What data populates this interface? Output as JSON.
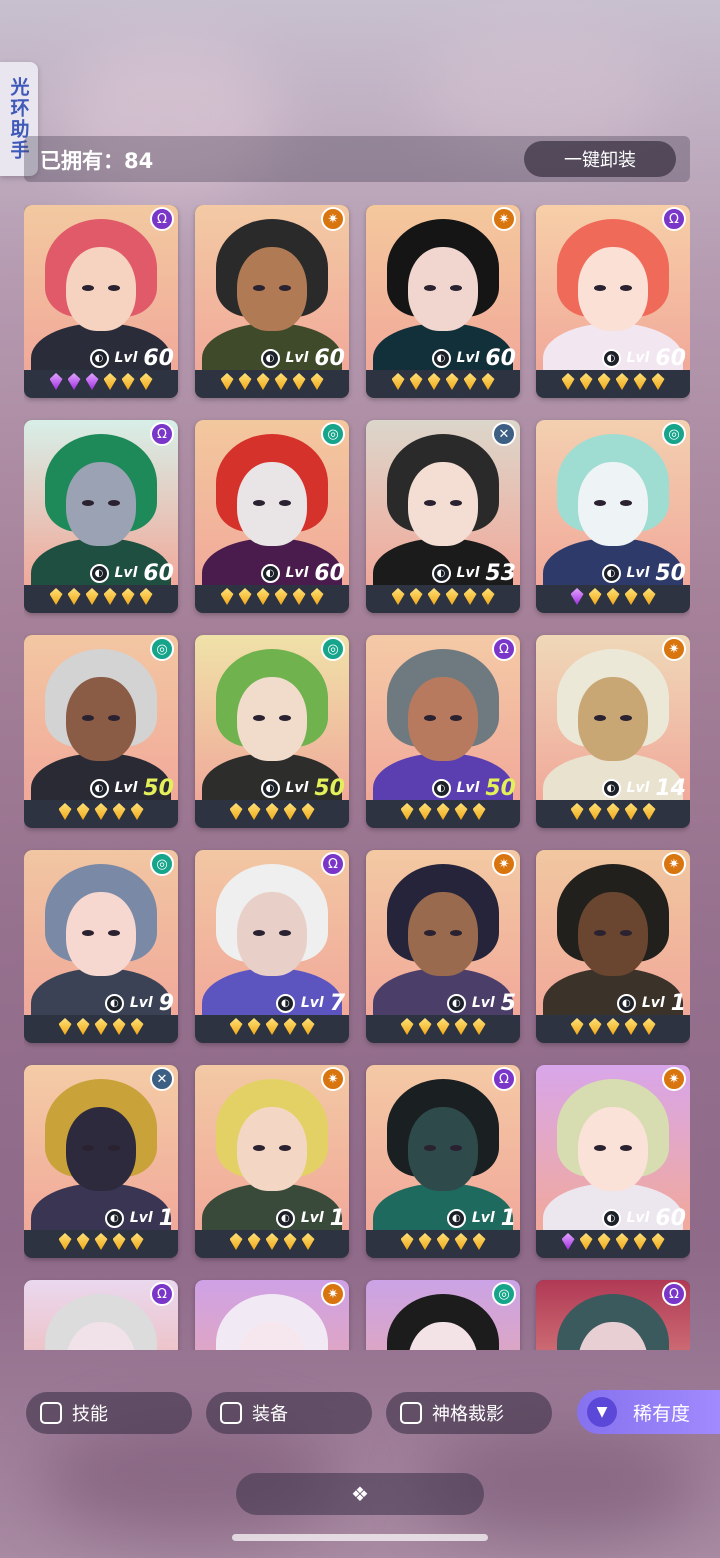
{
  "side_tab": {
    "label": "光环助手"
  },
  "owned": {
    "label": "已拥有：84"
  },
  "unequip_button": {
    "label": "一键卸装"
  },
  "cards": [
    {
      "level": "60",
      "element": "arcane",
      "gems": "pppyyy",
      "bg": "#f2c9a0",
      "hair": "#e05a6a",
      "skin": "#f6d2c0",
      "outfit": "#2b2c3a"
    },
    {
      "level": "60",
      "element": "solar",
      "gems": "yyyyyy",
      "bg": "#f3caa4",
      "hair": "#2a2a2a",
      "skin": "#b07a55",
      "outfit": "#3f4a2a"
    },
    {
      "level": "60",
      "element": "solar",
      "gems": "yyyyyy",
      "bg": "#f4c89c",
      "hair": "#151515",
      "skin": "#f0d6cf",
      "outfit": "#12303a"
    },
    {
      "level": "60",
      "element": "arcane",
      "gems": "yyyyyy",
      "bg": "#f7cfa8",
      "hair": "#f06a5a",
      "skin": "#fbe0d6",
      "outfit": "#f2e6f0"
    },
    {
      "level": "60",
      "element": "arcane",
      "gems": "yyyyyy",
      "bg": "#d7efe8",
      "hair": "#1e8a5a",
      "skin": "#9aa2b4",
      "outfit": "#1f4f40"
    },
    {
      "level": "60",
      "element": "void",
      "gems": "yyyyyy",
      "bg": "#f3c89e",
      "hair": "#d5322c",
      "skin": "#e9e4e6",
      "outfit": "#4a1b4d"
    },
    {
      "level": "53",
      "element": "strand",
      "gems": "yyyyyy",
      "bg": "#dcd6cb",
      "hair": "#2a2a2a",
      "skin": "#f4ddd3",
      "outfit": "#1b1b1b"
    },
    {
      "level": "50",
      "element": "void",
      "gems": "pyyyy",
      "bg": "#f3d0b0",
      "hair": "#9fdcd2",
      "skin": "#eef4f6",
      "outfit": "#2d3a6a"
    },
    {
      "level": "50",
      "element": "void",
      "gems": "yyyyy",
      "bg": "#f3c7a2",
      "hair": "#d3d3d3",
      "skin": "#8a5b45",
      "outfit": "#2a2a35",
      "yellow": true
    },
    {
      "level": "50",
      "element": "void",
      "gems": "yyyyy",
      "bg": "#efe2a8",
      "hair": "#6fb24e",
      "skin": "#f1dccc",
      "outfit": "#2d2e2b",
      "yellow": true
    },
    {
      "level": "50",
      "element": "arcane",
      "gems": "yyyyy",
      "bg": "#f4caa6",
      "hair": "#6f7a80",
      "skin": "#b77a5f",
      "outfit": "#5b3fb0",
      "yellow": true
    },
    {
      "level": "14",
      "element": "solar",
      "gems": "yyyyy",
      "bg": "#efd8b8",
      "hair": "#ece8d8",
      "skin": "#c9a775",
      "outfit": "#e8e2cf"
    },
    {
      "level": "9",
      "element": "void",
      "gems": "yyyyy",
      "bg": "#f1c6a2",
      "hair": "#7a8aa6",
      "skin": "#f6d8d0",
      "outfit": "#3c4256"
    },
    {
      "level": "7",
      "element": "arcane",
      "gems": "yyyyy",
      "bg": "#f2c7a3",
      "hair": "#efefef",
      "skin": "#e8d0c8",
      "outfit": "#5c55c0"
    },
    {
      "level": "5",
      "element": "solar",
      "gems": "yyyyy",
      "bg": "#f3c9a3",
      "hair": "#25243a",
      "skin": "#9a6a4e",
      "outfit": "#4b3f6a"
    },
    {
      "level": "1",
      "element": "solar",
      "gems": "yyyyy",
      "bg": "#f1c7a0",
      "hair": "#22201c",
      "skin": "#6a4630",
      "outfit": "#3b322a"
    },
    {
      "level": "1",
      "element": "strand",
      "gems": "yyyyy",
      "bg": "#f4cca6",
      "hair": "#c9a23a",
      "skin": "#2e2a3e",
      "outfit": "#3a3552"
    },
    {
      "level": "1",
      "element": "solar",
      "gems": "yyyyy",
      "bg": "#f3c9a4",
      "hair": "#e3d165",
      "skin": "#f3d7c4",
      "outfit": "#3a4a3a"
    },
    {
      "level": "1",
      "element": "arcane",
      "gems": "yyyyy",
      "bg": "#f4c9a5",
      "hair": "#1a1f22",
      "skin": "#2e4a4a",
      "outfit": "#1f6a5e"
    },
    {
      "level": "60",
      "element": "solar",
      "gems": "pyyyyy",
      "bg": "#d8a6ea",
      "hair": "#d7ddb0",
      "skin": "#fbe2d8",
      "outfit": "#ece6ef"
    },
    {
      "level": "",
      "element": "arcane",
      "gems": "",
      "bg": "#ead8ee",
      "hair": "#dcdcdc",
      "skin": "#f0e2e8",
      "outfit": "#ddd"
    },
    {
      "level": "",
      "element": "solar",
      "gems": "",
      "bg": "#cfa2e6",
      "hair": "#f1eaf4",
      "skin": "#f6e6ee",
      "outfit": "#2a2a35"
    },
    {
      "level": "",
      "element": "void",
      "gems": "",
      "bg": "#cba3e6",
      "hair": "#1c1c1c",
      "skin": "#f3e2e6",
      "outfit": "#222"
    },
    {
      "level": "",
      "element": "arcane",
      "gems": "",
      "bg": "#b03a55",
      "hair": "#3a5a5e",
      "skin": "#e7cfd3",
      "outfit": "#2a2a2a"
    }
  ],
  "element_icons": {
    "arcane": {
      "glyph": "Ω",
      "color": "#7a35c9"
    },
    "solar": {
      "glyph": "✷",
      "color": "#d9750f"
    },
    "void": {
      "glyph": "◎",
      "color": "#16a48a"
    },
    "strand": {
      "glyph": "✕",
      "color": "#3d5f83"
    }
  },
  "level_prefix": "Lvl",
  "filters": {
    "skill": "技能",
    "equipment": "装备",
    "divinity": "神格裁影",
    "rarity": "稀有度"
  },
  "bottom_pill_icon": "❖"
}
